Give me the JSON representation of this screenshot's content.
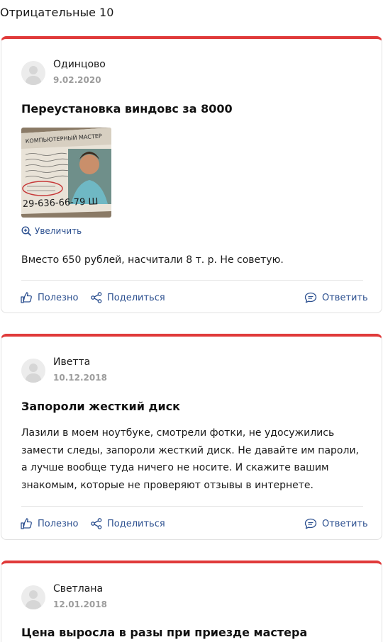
{
  "section": {
    "title": "Отрицательные 10"
  },
  "actions": {
    "helpful": "Полезно",
    "share": "Поделиться",
    "reply": "Ответить",
    "zoom": "Увеличить"
  },
  "reviews": [
    {
      "author": "Одинцово",
      "date": "9.02.2020",
      "title": "Переустановка виндовс за 8000",
      "text": "Вместо 650 рублей, насчитали 8 т. р. Не советую.",
      "photo": {
        "heading": "КОМПЬЮТЕРНЫЙ МАСТЕР",
        "phone": "29-636-66-79 Ш"
      }
    },
    {
      "author": "Иветта",
      "date": "10.12.2018",
      "title": "Запороли жесткий диск",
      "text": "Лазили в моем ноутбуке, смотрели фотки, не удосужились замести следы, запороли жесткий диск. Не давайте им пароли, а лучше вообще туда ничего не носите. И скажите вашим знакомым, которые не проверяют отзывы в интернете."
    },
    {
      "author": "Светлана",
      "date": "12.01.2018",
      "title": "Цена выросла в разы при приезде мастера"
    }
  ],
  "colors": {
    "accent": "#e03a3a",
    "link": "#2b4f8f",
    "muted": "#9c9c9c"
  }
}
